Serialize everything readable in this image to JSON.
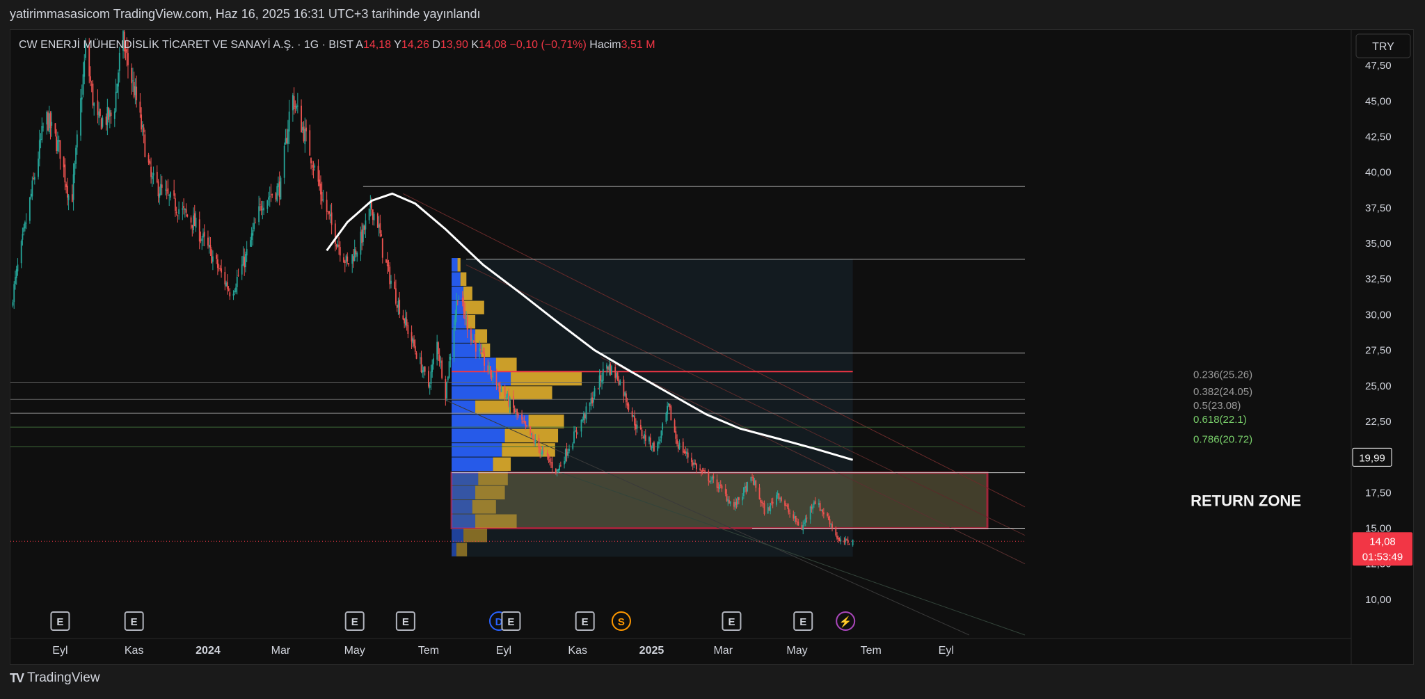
{
  "published_line": "yatirimmasasicom TradingView.com, Haz 16, 2025 16:31 UTC+3 tarihinde yayınlandı",
  "footer": {
    "brand": "TradingView",
    "logo_icon": "tradingview-logo-icon"
  },
  "header": {
    "symbol": "CW ENERJİ MÜHENDİSLİK TİCARET VE SANAYİ A.Ş. · 1G · BIST",
    "ohlc": [
      {
        "label": "A",
        "value": "14,18"
      },
      {
        "label": "Y",
        "value": "14,26"
      },
      {
        "label": "D",
        "value": "13,90"
      },
      {
        "label": "K",
        "value": "14,08"
      }
    ],
    "change": "−0,10 (−0,71%)",
    "volume_label": "Hacim",
    "volume_value": "3,51 M",
    "currency_button": "TRY"
  },
  "colors": {
    "up": "#26a69a",
    "down": "#ef5350",
    "accent_red": "#f23645",
    "fib_green": "#7ad16b",
    "vp_blue": "#2962ff",
    "vp_yellow": "#e0ad2a"
  },
  "chart_data": {
    "type": "candlestick",
    "y_axis": {
      "range": [
        7.5,
        50.0
      ],
      "ticks": [
        "10,00",
        "12,50",
        "15,00",
        "17,50",
        "20,00",
        "22,50",
        "25,00",
        "27,50",
        "30,00",
        "32,50",
        "35,00",
        "37,50",
        "40,00",
        "42,50",
        "45,00",
        "47,50"
      ],
      "position": "right"
    },
    "x_axis": {
      "range": [
        "2023-07-22",
        "2025-11-05"
      ],
      "ticks": [
        {
          "label": "Eyl",
          "date": "2023-09-01",
          "bold": false
        },
        {
          "label": "Kas",
          "date": "2023-11-01",
          "bold": false
        },
        {
          "label": "2024",
          "date": "2024-01-01",
          "bold": true
        },
        {
          "label": "Mar",
          "date": "2024-03-01",
          "bold": false
        },
        {
          "label": "May",
          "date": "2024-05-01",
          "bold": false
        },
        {
          "label": "Tem",
          "date": "2024-07-01",
          "bold": false
        },
        {
          "label": "Eyl",
          "date": "2024-09-01",
          "bold": false
        },
        {
          "label": "Kas",
          "date": "2024-11-01",
          "bold": false
        },
        {
          "label": "2025",
          "date": "2025-01-01",
          "bold": true
        },
        {
          "label": "Mar",
          "date": "2025-03-01",
          "bold": false
        },
        {
          "label": "May",
          "date": "2025-05-01",
          "bold": false
        },
        {
          "label": "Tem",
          "date": "2025-07-01",
          "bold": false
        },
        {
          "label": "Eyl",
          "date": "2025-09-01",
          "bold": false
        }
      ]
    },
    "price_path": [
      [
        "2023-07-22",
        30.5
      ],
      [
        "2023-08-05",
        37.0
      ],
      [
        "2023-08-20",
        44.0
      ],
      [
        "2023-09-01",
        41.5
      ],
      [
        "2023-09-10",
        37.5
      ],
      [
        "2023-09-22",
        48.5
      ],
      [
        "2023-10-01",
        43.5
      ],
      [
        "2023-10-15",
        44.0
      ],
      [
        "2023-10-22",
        49.5
      ],
      [
        "2023-11-03",
        45.0
      ],
      [
        "2023-11-15",
        39.5
      ],
      [
        "2023-12-01",
        38.0
      ],
      [
        "2023-12-20",
        36.5
      ],
      [
        "2024-01-05",
        34.0
      ],
      [
        "2024-01-20",
        31.5
      ],
      [
        "2024-02-01",
        34.0
      ],
      [
        "2024-02-15",
        38.0
      ],
      [
        "2024-03-01",
        39.0
      ],
      [
        "2024-03-10",
        45.5
      ],
      [
        "2024-03-25",
        41.5
      ],
      [
        "2024-04-05",
        38.0
      ],
      [
        "2024-04-15",
        35.5
      ],
      [
        "2024-04-25",
        33.5
      ],
      [
        "2024-05-05",
        35.0
      ],
      [
        "2024-05-15",
        37.5
      ],
      [
        "2024-05-20",
        36.5
      ],
      [
        "2024-05-25",
        34.0
      ],
      [
        "2024-06-05",
        31.0
      ],
      [
        "2024-06-20",
        27.5
      ],
      [
        "2024-07-01",
        25.0
      ],
      [
        "2024-07-08",
        28.0
      ],
      [
        "2024-07-15",
        24.5
      ],
      [
        "2024-07-25",
        31.5
      ],
      [
        "2024-08-05",
        28.5
      ],
      [
        "2024-08-20",
        26.0
      ],
      [
        "2024-09-01",
        24.5
      ],
      [
        "2024-09-15",
        22.5
      ],
      [
        "2024-10-01",
        20.5
      ],
      [
        "2024-10-15",
        19.0
      ],
      [
        "2024-11-01",
        22.0
      ],
      [
        "2024-11-10",
        23.5
      ],
      [
        "2024-11-25",
        26.5
      ],
      [
        "2024-12-05",
        25.5
      ],
      [
        "2024-12-20",
        22.0
      ],
      [
        "2025-01-05",
        20.5
      ],
      [
        "2025-01-15",
        23.5
      ],
      [
        "2025-01-22",
        21.0
      ],
      [
        "2025-02-10",
        19.0
      ],
      [
        "2025-02-25",
        18.0
      ],
      [
        "2025-03-10",
        16.5
      ],
      [
        "2025-03-25",
        18.5
      ],
      [
        "2025-04-05",
        16.0
      ],
      [
        "2025-04-15",
        17.5
      ],
      [
        "2025-04-25",
        16.0
      ],
      [
        "2025-05-05",
        15.0
      ],
      [
        "2025-05-15",
        17.0
      ],
      [
        "2025-05-28",
        15.5
      ],
      [
        "2025-06-05",
        14.0
      ],
      [
        "2025-06-16",
        14.08
      ]
    ],
    "moving_average": {
      "color": "#ffffff",
      "points": [
        [
          "2024-04-08",
          34.5
        ],
        [
          "2024-04-25",
          36.5
        ],
        [
          "2024-05-15",
          38.0
        ],
        [
          "2024-06-01",
          38.5
        ],
        [
          "2024-06-20",
          37.8
        ],
        [
          "2024-07-15",
          36.0
        ],
        [
          "2024-08-15",
          33.5
        ],
        [
          "2024-09-15",
          31.5
        ],
        [
          "2024-10-15",
          29.5
        ],
        [
          "2024-11-15",
          27.5
        ],
        [
          "2024-12-15",
          26.0
        ],
        [
          "2025-01-15",
          24.5
        ],
        [
          "2025-02-15",
          23.0
        ],
        [
          "2025-03-15",
          22.0
        ],
        [
          "2025-04-15",
          21.3
        ],
        [
          "2025-05-15",
          20.6
        ],
        [
          "2025-06-16",
          19.8
        ]
      ]
    },
    "horizontal_levels": [
      {
        "price": 39.0,
        "from": "2024-05-08",
        "to": "2025-11-05",
        "color": "#b0b0b0"
      },
      {
        "price": 33.9,
        "from": "2024-08-01",
        "to": "2025-11-05",
        "color": "#b0b0b0"
      },
      {
        "price": 27.3,
        "from": "2024-11-20",
        "to": "2025-11-05",
        "color": "#b0b0b0"
      },
      {
        "price": 25.26,
        "from": "2023-07-22",
        "to": "2025-11-05",
        "color": "#666666"
      },
      {
        "price": 24.05,
        "from": "2023-07-22",
        "to": "2025-11-05",
        "color": "#666666"
      },
      {
        "price": 23.08,
        "from": "2023-07-22",
        "to": "2025-11-05",
        "color": "#8a8a8a"
      },
      {
        "price": 22.1,
        "from": "2023-07-22",
        "to": "2025-11-05",
        "color": "#3f6b39"
      },
      {
        "price": 20.72,
        "from": "2023-07-22",
        "to": "2025-11-05",
        "color": "#3f6b39"
      },
      {
        "price": 26.0,
        "from": "2024-07-20",
        "to": "2025-06-16",
        "color": "#f23645"
      },
      {
        "price": 18.9,
        "from": "2024-07-20",
        "to": "2025-11-05",
        "color": "#cccccc"
      },
      {
        "price": 15.0,
        "from": "2025-03-25",
        "to": "2025-11-05",
        "color": "#cccccc"
      }
    ],
    "price_marker": {
      "price": 14.08,
      "value": "14,08",
      "countdown": "01:53:49",
      "color": "#f23645"
    },
    "ma_marker": {
      "price": 19.99,
      "value": "19,99"
    },
    "fib_labels": [
      {
        "text": "0.236(25.26)",
        "price": 25.26,
        "color": "#9a9a9a"
      },
      {
        "text": "0.382(24.05)",
        "price": 24.05,
        "color": "#9a9a9a"
      },
      {
        "text": "0.5(23.08)",
        "price": 23.08,
        "color": "#9a9a9a"
      },
      {
        "text": "0.618(22.1)",
        "price": 22.1,
        "color": "#7ad16b"
      },
      {
        "text": "0.786(20.72)",
        "price": 20.72,
        "color": "#7ad16b"
      }
    ],
    "return_zone": {
      "label": "RETURN ZONE",
      "top": 18.9,
      "bottom": 15.0,
      "from": "2024-07-20",
      "to": "2025-10-05"
    },
    "volume_profile": {
      "range_from": "2024-07-20",
      "range_to": "2025-06-16",
      "rows": [
        {
          "price": 33.5,
          "blue": 0.1,
          "yellow": 0.05
        },
        {
          "price": 32.5,
          "blue": 0.15,
          "yellow": 0.1
        },
        {
          "price": 31.5,
          "blue": 0.2,
          "yellow": 0.15
        },
        {
          "price": 30.5,
          "blue": 0.2,
          "yellow": 0.35
        },
        {
          "price": 29.5,
          "blue": 0.25,
          "yellow": 0.15
        },
        {
          "price": 28.5,
          "blue": 0.4,
          "yellow": 0.2
        },
        {
          "price": 27.5,
          "blue": 0.5,
          "yellow": 0.15
        },
        {
          "price": 26.5,
          "blue": 0.75,
          "yellow": 0.35
        },
        {
          "price": 25.5,
          "blue": 1.0,
          "yellow": 1.2
        },
        {
          "price": 24.5,
          "blue": 0.8,
          "yellow": 0.9
        },
        {
          "price": 23.5,
          "blue": 0.4,
          "yellow": 0.6
        },
        {
          "price": 22.5,
          "blue": 1.3,
          "yellow": 0.6
        },
        {
          "price": 21.5,
          "blue": 0.9,
          "yellow": 0.9
        },
        {
          "price": 20.5,
          "blue": 0.85,
          "yellow": 0.9
        },
        {
          "price": 19.5,
          "blue": 0.7,
          "yellow": 0.3
        },
        {
          "price": 18.5,
          "blue": 0.45,
          "yellow": 0.5
        },
        {
          "price": 17.5,
          "blue": 0.4,
          "yellow": 0.5
        },
        {
          "price": 16.5,
          "blue": 0.35,
          "yellow": 0.4
        },
        {
          "price": 15.5,
          "blue": 0.4,
          "yellow": 0.7
        },
        {
          "price": 14.5,
          "blue": 0.2,
          "yellow": 0.4
        },
        {
          "price": 13.5,
          "blue": 0.08,
          "yellow": 0.18
        }
      ]
    },
    "event_markers": [
      {
        "date": "2023-09-01",
        "glyph": "E",
        "kind": "earnings"
      },
      {
        "date": "2023-11-01",
        "glyph": "E",
        "kind": "earnings"
      },
      {
        "date": "2024-05-01",
        "glyph": "E",
        "kind": "earnings"
      },
      {
        "date": "2024-06-12",
        "glyph": "E",
        "kind": "earnings"
      },
      {
        "date": "2024-08-28",
        "glyph": "D",
        "kind": "dividend"
      },
      {
        "date": "2024-09-07",
        "glyph": "E",
        "kind": "earnings"
      },
      {
        "date": "2024-11-07",
        "glyph": "E",
        "kind": "earnings"
      },
      {
        "date": "2024-12-07",
        "glyph": "S",
        "kind": "split"
      },
      {
        "date": "2025-03-08",
        "glyph": "E",
        "kind": "earnings"
      },
      {
        "date": "2025-05-06",
        "glyph": "E",
        "kind": "earnings"
      },
      {
        "date": "2025-06-10",
        "glyph": "⚡",
        "kind": "news"
      }
    ]
  }
}
